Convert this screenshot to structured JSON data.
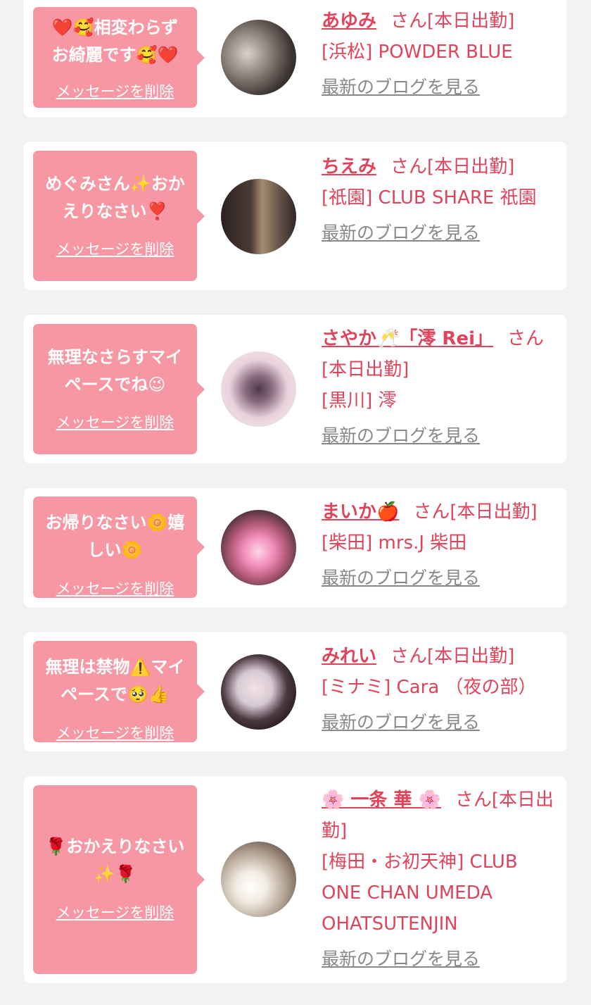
{
  "delete_label": "メッセージを削除",
  "blog_label": "最新のブログを見る",
  "cards": [
    {
      "message": "❤️🥰相変わらず\nお綺麗です🥰❤️",
      "name": "あゆみ",
      "suffix": "さん[本日出勤]",
      "shop": "[浜松] POWDER BLUE"
    },
    {
      "message": "めぐみさん✨おか\nえりなさい❣️",
      "name": "ちえみ",
      "suffix": "さん[本日出勤]",
      "shop": "[祇園] CLUB SHARE 祇園"
    },
    {
      "message": "無理なさらすマイ\nペースでね😉",
      "name": "さやか🥂「澪 Rei」",
      "suffix": "さん[本日出勤]",
      "shop": "[黒川] 澪"
    },
    {
      "message": "お帰りなさい🌼嬉\nしい🌼",
      "name": "まいか🍎",
      "suffix": "さん[本日出勤]",
      "shop": "[柴田] mrs.J 柴田"
    },
    {
      "message": "無理は禁物⚠️マイ\nペースで🥺👍",
      "name": "みれい",
      "suffix": "さん[本日出勤]",
      "shop": "[ミナミ] Cara （夜の部）"
    },
    {
      "message": "🌹おかえりなさい\n✨🌹",
      "name": "🌸 一条 華 🌸",
      "suffix": "さん[本日出勤]",
      "shop": "[梅田・お初天神] CLUB ONE CHAN UMEDA OHATSUTENJIN"
    }
  ],
  "colors": {
    "bubble": "#f797a4",
    "accent": "#e0445b",
    "link_gray": "#888888",
    "background": "#f2f2f2"
  }
}
